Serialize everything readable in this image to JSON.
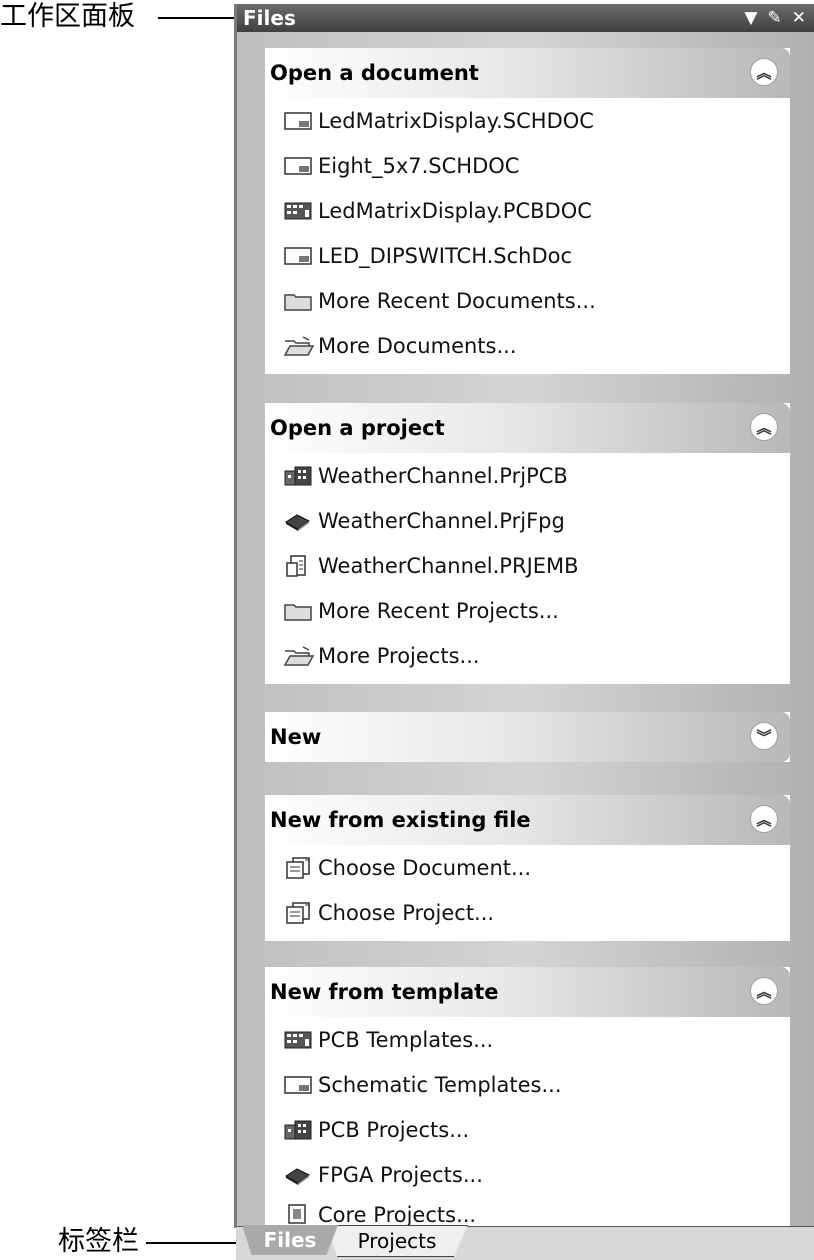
{
  "callouts": {
    "workspace_panel": "工作区面板",
    "tab_bar": "标签栏"
  },
  "panel": {
    "title": "Files",
    "controls": [
      "dropdown-arrow-icon",
      "pin-icon",
      "close-icon"
    ]
  },
  "groups": [
    {
      "title": "Open a document",
      "toggle": "collapse",
      "items": [
        {
          "label": "LedMatrixDisplay.SCHDOC",
          "icon": "schematic-doc-icon"
        },
        {
          "label": "Eight_5x7.SCHDOC",
          "icon": "schematic-doc-icon"
        },
        {
          "label": "LedMatrixDisplay.PCBDOC",
          "icon": "pcb-doc-icon"
        },
        {
          "label": "LED_DIPSWITCH.SchDoc",
          "icon": "schematic-doc-icon"
        },
        {
          "label": "More Recent Documents...",
          "icon": "folder-icon"
        },
        {
          "label": "More Documents...",
          "icon": "open-folder-icon"
        }
      ]
    },
    {
      "title": "Open a project",
      "toggle": "collapse",
      "items": [
        {
          "label": "WeatherChannel.PrjPCB",
          "icon": "pcb-project-icon"
        },
        {
          "label": "WeatherChannel.PrjFpg",
          "icon": "fpga-project-icon"
        },
        {
          "label": "WeatherChannel.PRJEMB",
          "icon": "embedded-project-icon"
        },
        {
          "label": "More Recent Projects...",
          "icon": "folder-icon"
        },
        {
          "label": "More Projects...",
          "icon": "open-folder-icon"
        }
      ]
    },
    {
      "title": "New",
      "toggle": "expand",
      "items": []
    },
    {
      "title": "New from existing file",
      "toggle": "collapse",
      "items": [
        {
          "label": "Choose Document...",
          "icon": "choose-file-icon"
        },
        {
          "label": "Choose Project...",
          "icon": "choose-file-icon"
        }
      ]
    },
    {
      "title": "New from template",
      "toggle": "collapse",
      "items": [
        {
          "label": "PCB Templates...",
          "icon": "pcb-doc-icon"
        },
        {
          "label": "Schematic Templates...",
          "icon": "schematic-doc-icon"
        },
        {
          "label": "PCB Projects...",
          "icon": "pcb-project-icon"
        },
        {
          "label": "FPGA Projects...",
          "icon": "fpga-project-icon"
        },
        {
          "label": "Core Projects...",
          "icon": "core-project-icon"
        }
      ]
    }
  ],
  "tabs": {
    "active": "Files",
    "inactive": "Projects"
  },
  "toggle_glyphs": {
    "collapse": "︽",
    "expand": "︾"
  }
}
